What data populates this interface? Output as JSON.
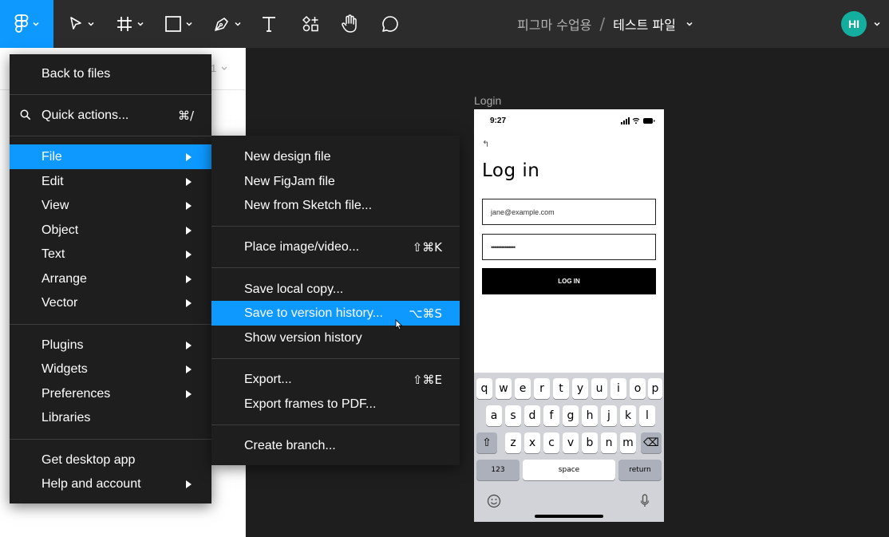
{
  "toolbar": {
    "tools": [
      {
        "name": "main-menu",
        "icon": "figma-logo-icon"
      },
      {
        "name": "move",
        "icon": "cursor-arrow-icon"
      },
      {
        "name": "frame",
        "icon": "frame-hash-icon"
      },
      {
        "name": "shape",
        "icon": "rectangle-icon"
      },
      {
        "name": "pen",
        "icon": "pen-icon"
      },
      {
        "name": "text",
        "icon": "text-tool-icon"
      },
      {
        "name": "resources",
        "icon": "resources-icon"
      },
      {
        "name": "hand",
        "icon": "hand-icon"
      },
      {
        "name": "comment",
        "icon": "comment-icon"
      }
    ],
    "team_name": "피그마 수업용",
    "separator": "/",
    "file_name": "테스트 파일",
    "avatar_initials": "HI",
    "accent_color": "#0d99ff",
    "avatar_color": "#14ae9e"
  },
  "left_panel": {
    "page_indicator": "1"
  },
  "main_menu": {
    "back_to_files": "Back to files",
    "quick_actions": {
      "label": "Quick actions...",
      "shortcut": "⌘/"
    },
    "items_1": [
      "File",
      "Edit",
      "View",
      "Object",
      "Text",
      "Arrange",
      "Vector"
    ],
    "items_2": [
      "Plugins",
      "Widgets",
      "Preferences",
      "Libraries"
    ],
    "items_3": [
      "Get desktop app",
      "Help and account"
    ],
    "active_item": "File"
  },
  "file_menu": {
    "new_design_file": "New design file",
    "new_figjam_file": "New FigJam file",
    "new_from_sketch": "New from Sketch file...",
    "place_image": {
      "label": "Place image/video...",
      "shortcut": "⇧⌘K"
    },
    "save_local_copy": "Save local copy...",
    "save_to_version_history": {
      "label": "Save to version history...",
      "shortcut": "⌥⌘S"
    },
    "show_version_history": "Show version history",
    "export": {
      "label": "Export...",
      "shortcut": "⇧⌘E"
    },
    "export_frames_pdf": "Export frames to PDF...",
    "create_branch": "Create branch...",
    "highlighted_item": "Save to version history..."
  },
  "canvas": {
    "frame_label": "Login",
    "phone": {
      "time": "9:27",
      "back_glyph": "↰",
      "title": "Log in",
      "email_value": "jane@example.com",
      "password_value": "••••••••••••••",
      "login_button": "LOG IN",
      "keyboard": {
        "row1": [
          "q",
          "w",
          "e",
          "r",
          "t",
          "y",
          "u",
          "i",
          "o",
          "p"
        ],
        "row2": [
          "a",
          "s",
          "d",
          "f",
          "g",
          "h",
          "j",
          "k",
          "l"
        ],
        "row3": [
          "z",
          "x",
          "c",
          "v",
          "b",
          "n",
          "m"
        ],
        "shift": "⇧",
        "delete": "⌫",
        "numbers": "123",
        "space": "space",
        "return": "return"
      }
    }
  }
}
